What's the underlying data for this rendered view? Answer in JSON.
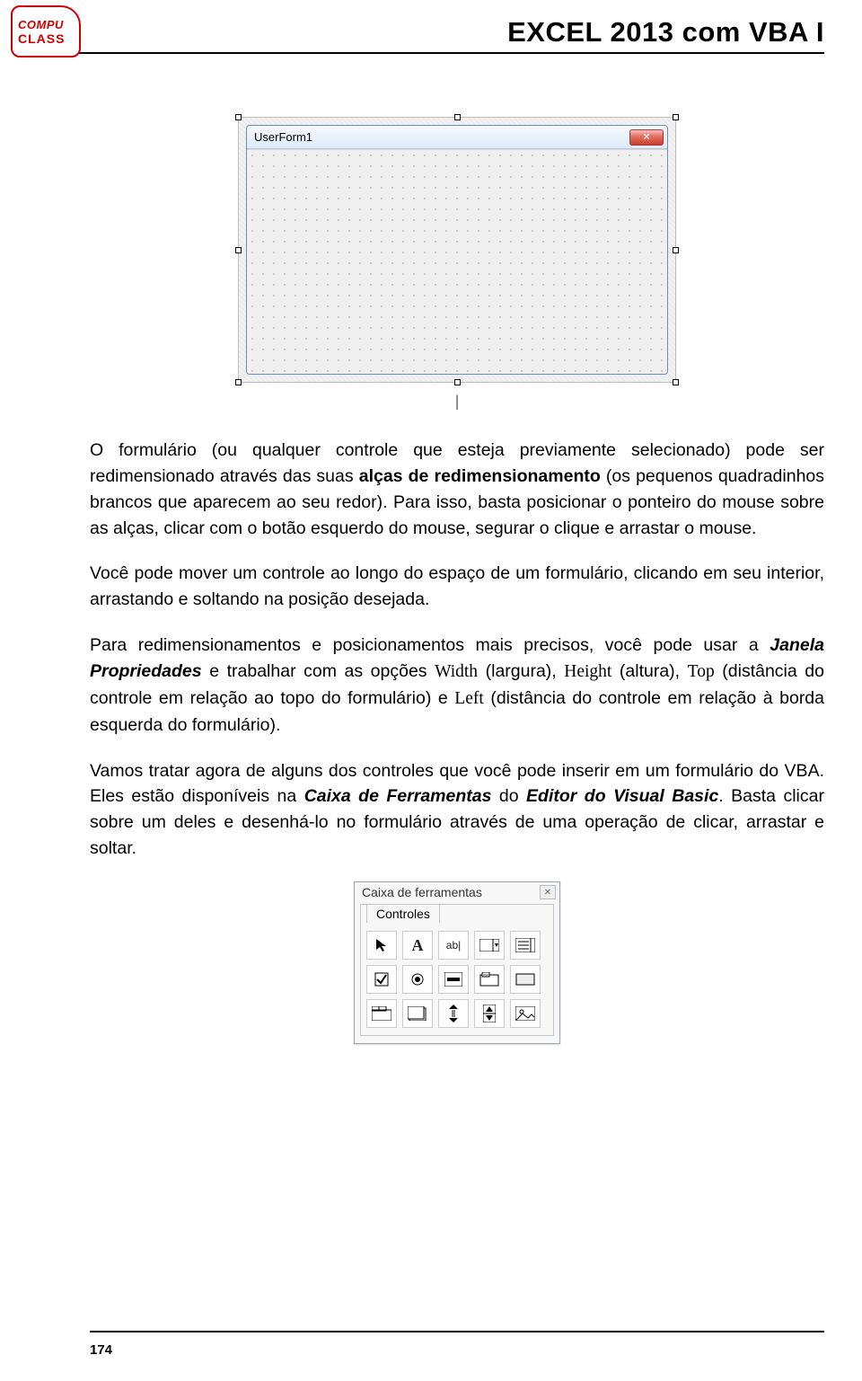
{
  "header": {
    "logo_top": "COMPU",
    "logo_bottom": "CLASS",
    "title": "EXCEL 2013 com VBA I"
  },
  "userform": {
    "title": "UserForm1",
    "close": "✕"
  },
  "paragraphs": {
    "p1_a": "O formulário (ou qualquer controle que esteja previamente selecionado) pode ser redimensionado através das suas ",
    "p1_b": "alças de redimensionamento",
    "p1_c": " (os pequenos quadradinhos brancos que aparecem ao seu redor). Para isso, basta posicionar o ponteiro do mouse sobre as alças, clicar com o botão esquerdo do mouse, segurar o clique e arrastar o mouse.",
    "p2": "Você pode mover um controle ao longo do espaço de um formulário, clicando em seu interior, arrastando e soltando na posição desejada.",
    "p3_a": "Para redimensionamentos e posicionamentos mais precisos, você pode usar a ",
    "p3_b": "Janela Propriedades",
    "p3_c": " e trabalhar com as opções ",
    "p3_w": "Width",
    "p3_d": " (largura), ",
    "p3_h": "Height",
    "p3_e": " (altura), ",
    "p3_t": "Top",
    "p3_f": " (distância do controle em relação ao topo do formulário) e ",
    "p3_l": "Left",
    "p3_g": " (distância do controle em relação à borda esquerda do formulário).",
    "p4_a": "Vamos tratar agora de alguns dos controles que você pode inserir em um formulário do VBA. Eles estão disponíveis na ",
    "p4_b": "Caixa de Ferramentas",
    "p4_c": " do ",
    "p4_d": "Editor do Visual Basic",
    "p4_e": ". Basta clicar sobre um deles e desenhá-lo no formulário através de uma operação de clicar, arrastar e soltar."
  },
  "toolbox": {
    "title": "Caixa de ferramentas",
    "close": "✕",
    "tab": "Controles"
  },
  "footer": {
    "page_number": "174"
  }
}
